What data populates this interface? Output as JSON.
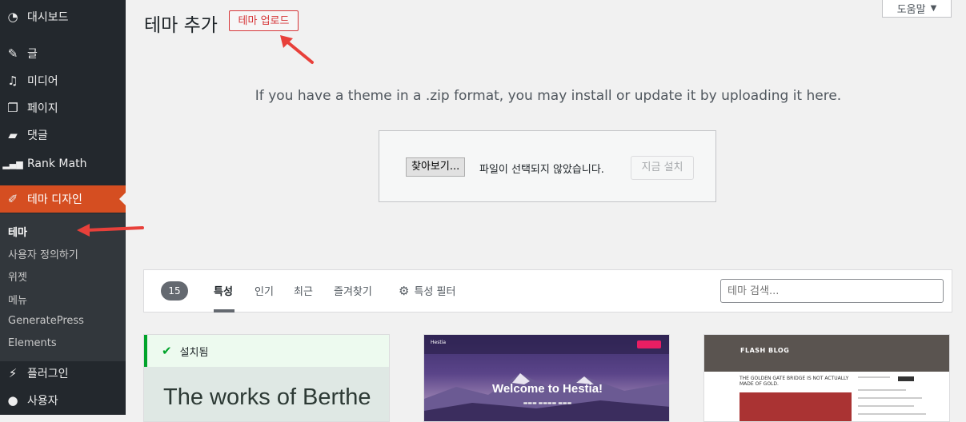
{
  "sidebar": {
    "items": [
      {
        "label": "대시보드",
        "icon": "dashboard-icon"
      },
      {
        "label": "글",
        "icon": "pin-icon"
      },
      {
        "label": "미디어",
        "icon": "media-icon"
      },
      {
        "label": "페이지",
        "icon": "pages-icon"
      },
      {
        "label": "댓글",
        "icon": "comments-icon"
      },
      {
        "label": "Rank Math",
        "icon": "rankmath-icon"
      },
      {
        "label": "테마 디자인",
        "icon": "brush-icon"
      },
      {
        "label": "플러그인",
        "icon": "plugin-icon"
      },
      {
        "label": "사용자",
        "icon": "user-icon"
      }
    ],
    "submenu": [
      "테마",
      "사용자 정의하기",
      "위젯",
      "메뉴",
      "GeneratePress",
      "Elements"
    ]
  },
  "header": {
    "title": "테마 추가",
    "upload_button": "테마 업로드",
    "help_button": "도움말"
  },
  "upload": {
    "instruction": "If you have a theme in a .zip format, you may install or update it by uploading it here.",
    "browse_button": "찾아보기...",
    "file_status": "파일이 선택되지 않았습니다.",
    "install_button": "지금 설치"
  },
  "filter": {
    "count": "15",
    "tabs": [
      "특성",
      "인기",
      "최근",
      "즐겨찾기"
    ],
    "feature_filter": "특성 필터",
    "search_placeholder": "테마 검색..."
  },
  "themes": [
    {
      "installed_label": "설치됨",
      "preview_text": "The works of Berthe"
    },
    {
      "preview_text": "Welcome to Hestia!"
    },
    {
      "preview_text": "FLASH BLOG",
      "headline": "THE GOLDEN GATE BRIDGE IS NOT ACTUALLY MADE OF GOLD."
    }
  ],
  "colors": {
    "sidebar_bg": "#23282d",
    "active_menu": "#d54e21",
    "annotation_arrow": "#e8403a",
    "installed_green": "#00a32a"
  }
}
